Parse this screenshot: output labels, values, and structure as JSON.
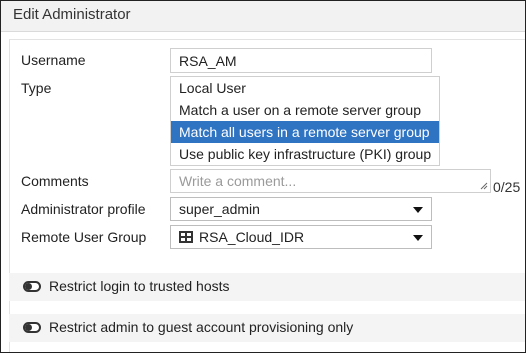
{
  "dialog": {
    "title": "Edit Administrator"
  },
  "form": {
    "username": {
      "label": "Username",
      "value": "RSA_AM"
    },
    "type": {
      "label": "Type",
      "options": [
        "Local User",
        "Match a user on a remote server group",
        "Match all users in a remote server group",
        "Use public key infrastructure (PKI) group"
      ],
      "selected_index": 2
    },
    "comments": {
      "label": "Comments",
      "placeholder": "Write a comment...",
      "counter": "0/25"
    },
    "admin_profile": {
      "label": "Administrator profile",
      "value": "super_admin"
    },
    "remote_group": {
      "label": "Remote User Group",
      "value": "RSA_Cloud_IDR",
      "icon": "server-group-icon"
    }
  },
  "toggles": {
    "trusted_hosts": {
      "label": "Restrict login to trusted hosts",
      "enabled": false
    },
    "guest_provisioning": {
      "label": "Restrict admin to guest account provisioning only",
      "enabled": false
    }
  },
  "colors": {
    "selected_bg": "#2f73c3",
    "title_bg": "#f2f2f2"
  }
}
